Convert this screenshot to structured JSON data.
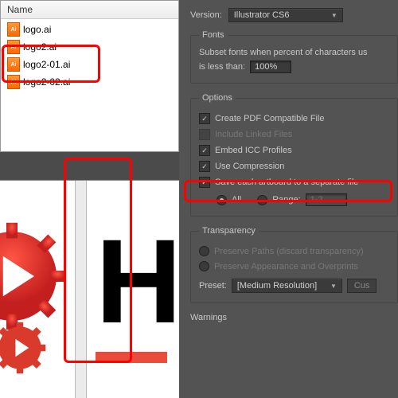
{
  "fileBrowser": {
    "header": "Name",
    "files": [
      {
        "name": "logo.ai"
      },
      {
        "name": "logo2.ai"
      },
      {
        "name": "logo2-01.ai"
      },
      {
        "name": "logo2-02.ai"
      }
    ]
  },
  "dialog": {
    "versionLabel": "Version:",
    "versionValue": "Illustrator CS6",
    "fonts": {
      "legend": "Fonts",
      "line1": "Subset fonts when percent of characters us",
      "line2": "is less than:",
      "value": "100%"
    },
    "options": {
      "legend": "Options",
      "createPdf": "Create PDF Compatible File",
      "includeLinked": "Include Linked Files",
      "embedIcc": "Embed ICC Profiles",
      "useCompression": "Use Compression",
      "saveArtboards": "Save each artboard to a separate file",
      "allLabel": "All",
      "rangeLabel": "Range:",
      "rangeValue": "1-2"
    },
    "transparency": {
      "legend": "Transparency",
      "preservePaths": "Preserve Paths (discard transparency)",
      "preserveAppearance": "Preserve Appearance and Overprints",
      "presetLabel": "Preset:",
      "presetValue": "[Medium Resolution]",
      "customBtn": "Cus"
    },
    "warningsLabel": "Warnings"
  }
}
